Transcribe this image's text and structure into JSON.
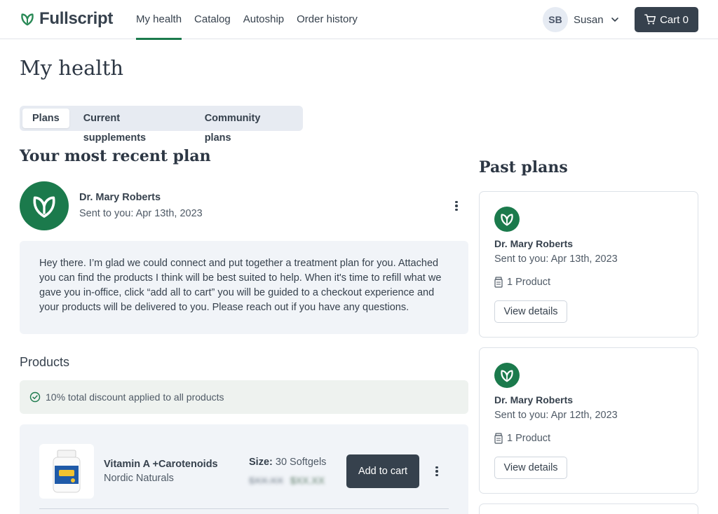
{
  "brand": {
    "name": "Fullscript",
    "logo_icon": "fullscript-leaf-icon",
    "accent": "#1b7a4c",
    "dark": "#36414d"
  },
  "nav": {
    "items": [
      {
        "label": "My health",
        "active": true
      },
      {
        "label": "Catalog",
        "active": false
      },
      {
        "label": "Autoship",
        "active": false
      },
      {
        "label": "Order history",
        "active": false
      }
    ]
  },
  "user": {
    "initials": "SB",
    "name": "Susan"
  },
  "cart": {
    "label": "Cart 0",
    "icon": "cart-icon"
  },
  "page": {
    "title": "My health"
  },
  "tabs": [
    {
      "label": "Plans",
      "active": true
    },
    {
      "label": "Current supplements",
      "active": false
    },
    {
      "label": "Community plans",
      "active": false
    }
  ],
  "recent_plan": {
    "heading": "Your most recent plan",
    "practitioner": "Dr. Mary Roberts",
    "sent": "Sent to you: Apr 13th, 2023",
    "message": "Hey there. I’m glad we could connect and put together a treatment plan for you. Attached you can find the products I think will be best suited to help. When it's time to refill what we gave you in-office, click “add all to cart” you will be guided to a checkout experience and your products will be delivered to you. Please reach out if you have any questions."
  },
  "products": {
    "heading": "Products",
    "discount": "10% total discount applied to all products",
    "items": [
      {
        "name": "Vitamin A +Carotenoids",
        "brand": "Nordic Naturals",
        "size_label": "Size:",
        "size_value": "30 Softgels",
        "old_price": "$XX.XX",
        "new_price": "$XX.XX",
        "add_label": "Add to cart"
      }
    ]
  },
  "past_plans": {
    "heading": "Past plans",
    "items": [
      {
        "practitioner": "Dr. Mary Roberts",
        "sent": "Sent to you: Apr 13th, 2023",
        "count": "1 Product",
        "button": "View details"
      },
      {
        "practitioner": "Dr. Mary Roberts",
        "sent": "Sent to you: Apr 12th, 2023",
        "count": "1 Product",
        "button": "View details"
      }
    ]
  }
}
